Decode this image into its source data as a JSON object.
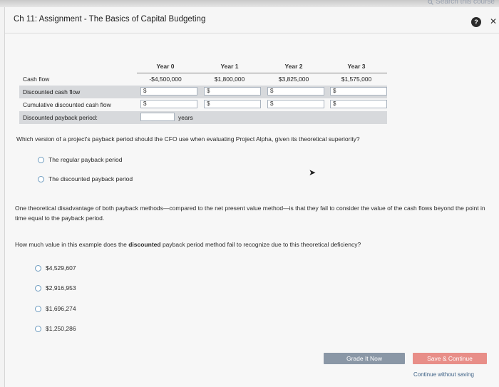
{
  "topbar": {
    "search_label": "Search this course"
  },
  "header": {
    "title": "Ch 11: Assignment - The Basics of Capital Budgeting"
  },
  "table": {
    "columns": [
      "",
      "Year 0",
      "Year 1",
      "Year 2",
      "Year 3"
    ],
    "rows": {
      "cash_flow": {
        "label": "Cash flow",
        "values": [
          "-$4,500,000",
          "$1,800,000",
          "$3,825,000",
          "$1,575,000"
        ]
      },
      "discounted_cash_flow": {
        "label": "Discounted cash flow",
        "currency": "$"
      },
      "cumulative_discounted": {
        "label": "Cumulative discounted cash flow",
        "currency": "$"
      },
      "discounted_payback": {
        "label": "Discounted payback period:",
        "unit": "years",
        "bullet": "-"
      }
    }
  },
  "question1": {
    "text": "Which version of a project's payback period should the CFO use when evaluating Project Alpha, given its theoretical superiority?",
    "options": [
      "The regular payback period",
      "The discounted payback period"
    ]
  },
  "paragraph": {
    "text": "One theoretical disadvantage of both payback methods—compared to the net present value method—is that they fail to consider the value of the cash flows beyond the point in time equal to the payback period."
  },
  "question2": {
    "prefix": "How much value in this example does the ",
    "emphasis": "discounted",
    "suffix": " payback period method fail to recognize due to this theoretical deficiency?",
    "options": [
      "$4,529,607",
      "$2,916,953",
      "$1,696,274",
      "$1,250,286"
    ]
  },
  "buttons": {
    "grade": "Grade It Now",
    "save": "Save & Continue",
    "continue": "Continue without saving"
  }
}
